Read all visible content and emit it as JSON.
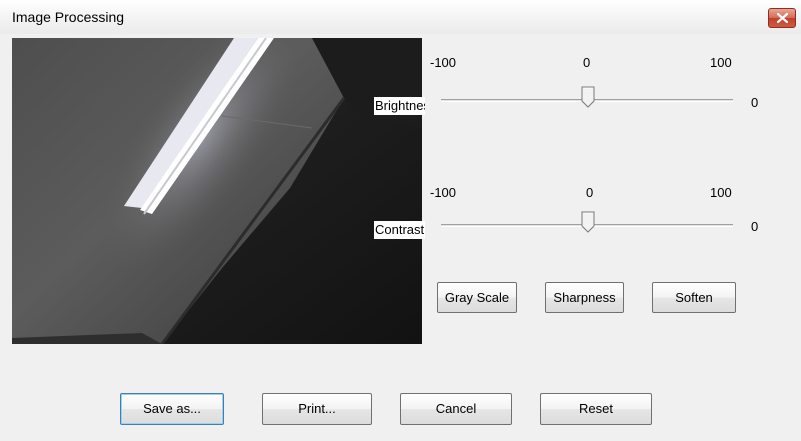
{
  "window": {
    "title": "Image Processing",
    "close_icon": "close-icon"
  },
  "brightness": {
    "label": "Brightness",
    "min_label": "-100",
    "mid_label": "0",
    "max_label": "100",
    "value": "0"
  },
  "contrast": {
    "label": "Contrast",
    "min_label": "-100",
    "mid_label": "0",
    "max_label": "100",
    "value": "0"
  },
  "filters": {
    "gray_scale": "Gray Scale",
    "sharpness": "Sharpness",
    "soften": "Soften"
  },
  "actions": {
    "save_as": "Save as...",
    "print": "Print...",
    "cancel": "Cancel",
    "reset": "Reset"
  },
  "colors": {
    "close_button": "#c3402a",
    "default_button_border": "#3c7fb1"
  }
}
